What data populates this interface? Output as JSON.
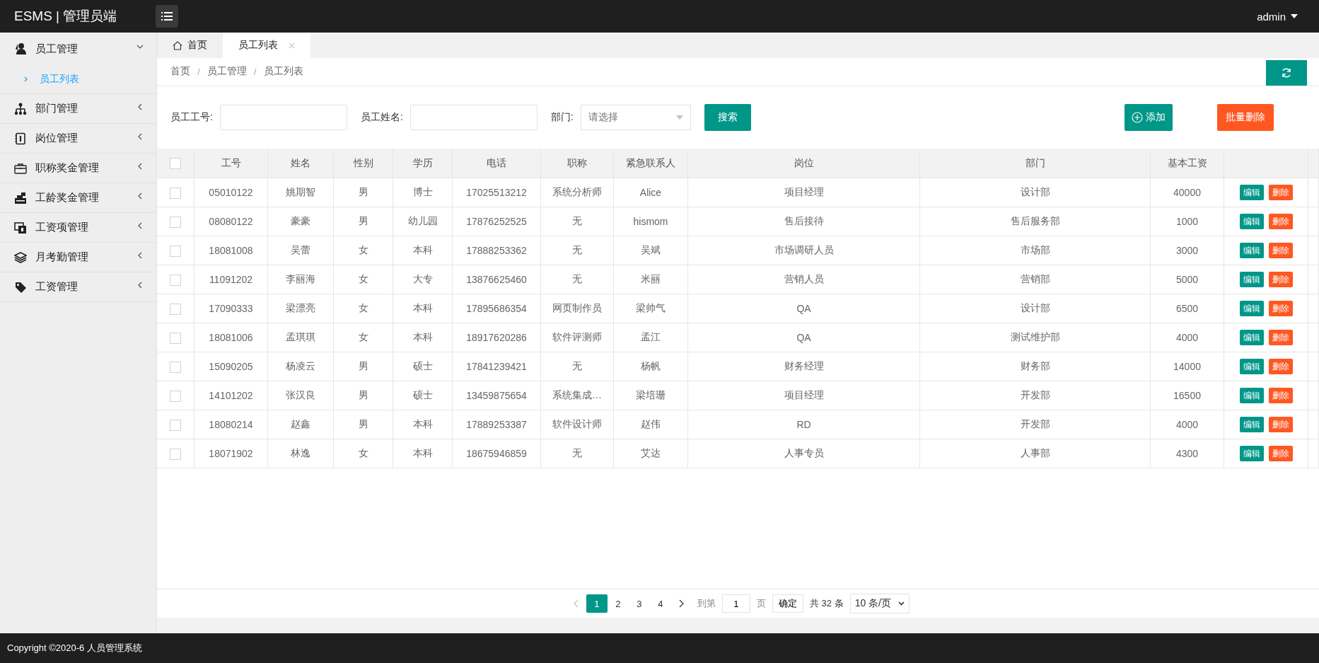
{
  "header": {
    "logo": "ESMS | 管理员端",
    "user": "admin"
  },
  "sidebar": {
    "items": [
      {
        "label": "员工管理",
        "expanded": true,
        "children": [
          {
            "label": "员工列表",
            "selected": true
          }
        ]
      },
      {
        "label": "部门管理",
        "expanded": false
      },
      {
        "label": "岗位管理",
        "expanded": false
      },
      {
        "label": "职称奖金管理",
        "expanded": false
      },
      {
        "label": "工龄奖金管理",
        "expanded": false
      },
      {
        "label": "工资项管理",
        "expanded": false
      },
      {
        "label": "月考勤管理",
        "expanded": false
      },
      {
        "label": "工资管理",
        "expanded": false
      }
    ]
  },
  "tabs": [
    {
      "label": "首页",
      "kind": "home",
      "selected": false
    },
    {
      "label": "员工列表",
      "kind": "closable",
      "selected": true
    }
  ],
  "breadcrumb": [
    {
      "kind": "link",
      "text": "首页"
    },
    {
      "kind": "separator",
      "text": "/"
    },
    {
      "kind": "link",
      "text": "员工管理"
    },
    {
      "kind": "separator",
      "text": "/"
    },
    {
      "kind": "link",
      "text": "员工列表"
    }
  ],
  "search": {
    "fields": [
      {
        "label": "员工工号:",
        "kind": "text"
      },
      {
        "label": "员工姓名:",
        "kind": "text"
      },
      {
        "label": "部门:",
        "kind": "select",
        "placeholder": "请选择"
      }
    ],
    "search_button": "搜索",
    "add_button": "添加",
    "batch_delete_button": "批量删除"
  },
  "table": {
    "header_checked": false,
    "columns": [
      "工号",
      "姓名",
      "性别",
      "学历",
      "电话",
      "职称",
      "紧急联系人",
      "岗位",
      "部门",
      "基本工资"
    ],
    "rows": [
      {
        "checked": false,
        "cells": [
          "05010122",
          "姚期智",
          "男",
          "博士",
          "17025513212",
          "系统分析师",
          "Alice",
          "项目经理",
          "设计部",
          "40000"
        ],
        "edit": "编辑",
        "delete": "删除"
      },
      {
        "checked": false,
        "cells": [
          "08080122",
          "豪豪",
          "男",
          "幼儿园",
          "17876252525",
          "无",
          "hismom",
          "售后接待",
          "售后服务部",
          "1000"
        ],
        "edit": "编辑",
        "delete": "删除"
      },
      {
        "checked": false,
        "cells": [
          "18081008",
          "吴蕾",
          "女",
          "本科",
          "17888253362",
          "无",
          "吴斌",
          "市场调研人员",
          "市场部",
          "3000"
        ],
        "edit": "编辑",
        "delete": "删除"
      },
      {
        "checked": false,
        "cells": [
          "11091202",
          "李丽海",
          "女",
          "大专",
          "13876625460",
          "无",
          "米丽",
          "营销人员",
          "营销部",
          "5000"
        ],
        "edit": "编辑",
        "delete": "删除"
      },
      {
        "checked": false,
        "cells": [
          "17090333",
          "梁漂亮",
          "女",
          "本科",
          "17895686354",
          "网页制作员",
          "梁帅气",
          "QA",
          "设计部",
          "6500"
        ],
        "edit": "编辑",
        "delete": "删除"
      },
      {
        "checked": false,
        "cells": [
          "18081006",
          "孟琪琪",
          "女",
          "本科",
          "18917620286",
          "软件评测师",
          "孟江",
          "QA",
          "测试维护部",
          "4000"
        ],
        "edit": "编辑",
        "delete": "删除"
      },
      {
        "checked": false,
        "cells": [
          "15090205",
          "杨凌云",
          "男",
          "硕士",
          "17841239421",
          "无",
          "杨帆",
          "财务经理",
          "财务部",
          "14000"
        ],
        "edit": "编辑",
        "delete": "删除"
      },
      {
        "checked": false,
        "cells": [
          "14101202",
          "张汉良",
          "男",
          "硕士",
          "13459875654",
          "系统集成…",
          "梁培珊",
          "项目经理",
          "开发部",
          "16500"
        ],
        "edit": "编辑",
        "delete": "删除"
      },
      {
        "checked": false,
        "cells": [
          "18080214",
          "赵鑫",
          "男",
          "本科",
          "17889253387",
          "软件设计师",
          "赵伟",
          "RD",
          "开发部",
          "4000"
        ],
        "edit": "编辑",
        "delete": "删除"
      },
      {
        "checked": false,
        "cells": [
          "18071902",
          "林逸",
          "女",
          "本科",
          "18675946859",
          "无",
          "艾达",
          "人事专员",
          "人事部",
          "4300"
        ],
        "edit": "编辑",
        "delete": "删除"
      }
    ]
  },
  "pagination": {
    "pages": [
      {
        "label": "1",
        "selected": true
      },
      {
        "label": "2",
        "selected": false
      },
      {
        "label": "3",
        "selected": false
      },
      {
        "label": "4",
        "selected": false
      }
    ],
    "prev_disabled": true,
    "goto_label": "到第",
    "goto_value": "1",
    "page_unit": "页",
    "confirm_button": "确定",
    "total": "共 32 条",
    "page_size": "10 条/页"
  },
  "footer": {
    "copyright": "Copyright ©2020-6 人员管理系统"
  }
}
